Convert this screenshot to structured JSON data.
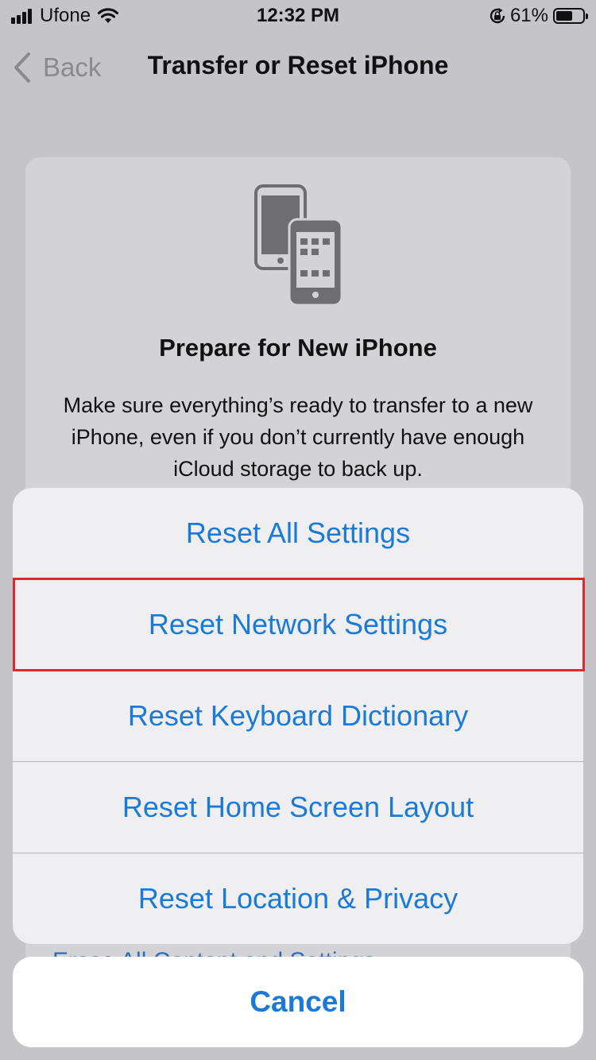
{
  "status_bar": {
    "carrier": "Ufone",
    "time": "12:32 PM",
    "battery_percent": "61%",
    "battery_level": 0.61,
    "icons": [
      "signal-icon",
      "wifi-icon",
      "orientation-lock-icon",
      "battery-icon"
    ]
  },
  "nav": {
    "back_label": "Back",
    "title": "Transfer or Reset iPhone"
  },
  "card": {
    "title": "Prepare for New iPhone",
    "description": "Make sure everything’s ready to transfer to a new iPhone, even if you don’t currently have enough iCloud storage to back up.",
    "obscured_option": "Erase All Content and Settings"
  },
  "action_sheet": {
    "items": [
      {
        "label": "Reset All Settings"
      },
      {
        "label": "Reset Network Settings",
        "highlighted": true
      },
      {
        "label": "Reset Keyboard Dictionary"
      },
      {
        "label": "Reset Home Screen Layout"
      },
      {
        "label": "Reset Location & Privacy"
      }
    ],
    "cancel_label": "Cancel"
  },
  "colors": {
    "accent": "#1a7ad6",
    "highlight_border": "#e0262e",
    "dimmed_background": "#c4c4c9"
  }
}
